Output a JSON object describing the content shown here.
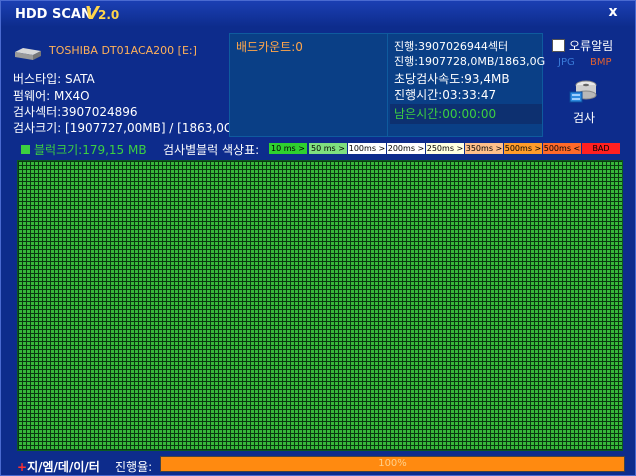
{
  "app": {
    "title": "HDD SCAN",
    "title_v": "V",
    "version": "2.0",
    "close_label": "x"
  },
  "drive": {
    "name": "TOSHIBA DT01ACA200 [E:]",
    "bus_type": "버스타입: SATA",
    "firmware": "펌웨어: MX4O",
    "sectors": "검사섹터:3907024896",
    "size": "검사크기: [1907727,00MB] / [1863,0GI"
  },
  "bad": {
    "label": "배드카운트:0"
  },
  "stats": {
    "progress_sectors": "진행:3907026944섹터",
    "progress_size": "진행:1907728,0MB/1863,0G",
    "speed": "초당검사속도:93,4MB",
    "elapsed": "진행시간:03:33:47",
    "remaining": "남은시간:00:00:00"
  },
  "options": {
    "error_alarm": "오류알림",
    "jpg": "JPG",
    "bmp": "BMP",
    "scan_label": "검사"
  },
  "blocks": {
    "size_label": "블럭크기:179,15 MB",
    "legend_title": "검사별블럭 색상표:",
    "legend": [
      {
        "label": "10 ms >",
        "color": "#2fd12f"
      },
      {
        "label": "50 ms >",
        "color": "#7fe07f"
      },
      {
        "label": "100ms >",
        "color": "#ffffff"
      },
      {
        "label": "200ms >",
        "color": "#ffffff"
      },
      {
        "label": "250ms >",
        "color": "#ffffe0"
      },
      {
        "label": "350ms >",
        "color": "#ffc08a"
      },
      {
        "label": "500ms >",
        "color": "#ff9c2a"
      },
      {
        "label": "500ms <",
        "color": "#ff6a2a"
      },
      {
        "label": "BAD",
        "color": "#ff2020"
      }
    ]
  },
  "footer": {
    "plus": "+",
    "data_label": "지/엠/데/이/터",
    "progress_label": "진행율:",
    "progress_text": "100%",
    "progress_value": 100
  },
  "colors": {
    "accent": "#ffd54a",
    "grid_block": "#37b83a",
    "progress": "#ff8a10"
  }
}
